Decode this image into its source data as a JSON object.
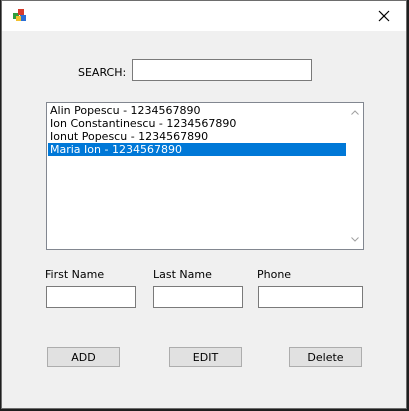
{
  "search": {
    "label": "SEARCH:",
    "value": ""
  },
  "contacts": {
    "items": [
      {
        "label": "Alin Popescu - 1234567890"
      },
      {
        "label": "Ion Constantinescu - 1234567890"
      },
      {
        "label": "Ionut Popescu - 1234567890"
      },
      {
        "label": "Maria Ion - 1234567890"
      }
    ],
    "selected_index": 3
  },
  "form": {
    "first_name_label": "First Name",
    "last_name_label": "Last Name",
    "phone_label": "Phone",
    "first_name_value": "",
    "last_name_value": "",
    "phone_value": ""
  },
  "buttons": {
    "add": "ADD",
    "edit": "EDIT",
    "delete": "Delete"
  },
  "colors": {
    "selection": "#0078d7",
    "window_bg": "#f0f0f0"
  }
}
